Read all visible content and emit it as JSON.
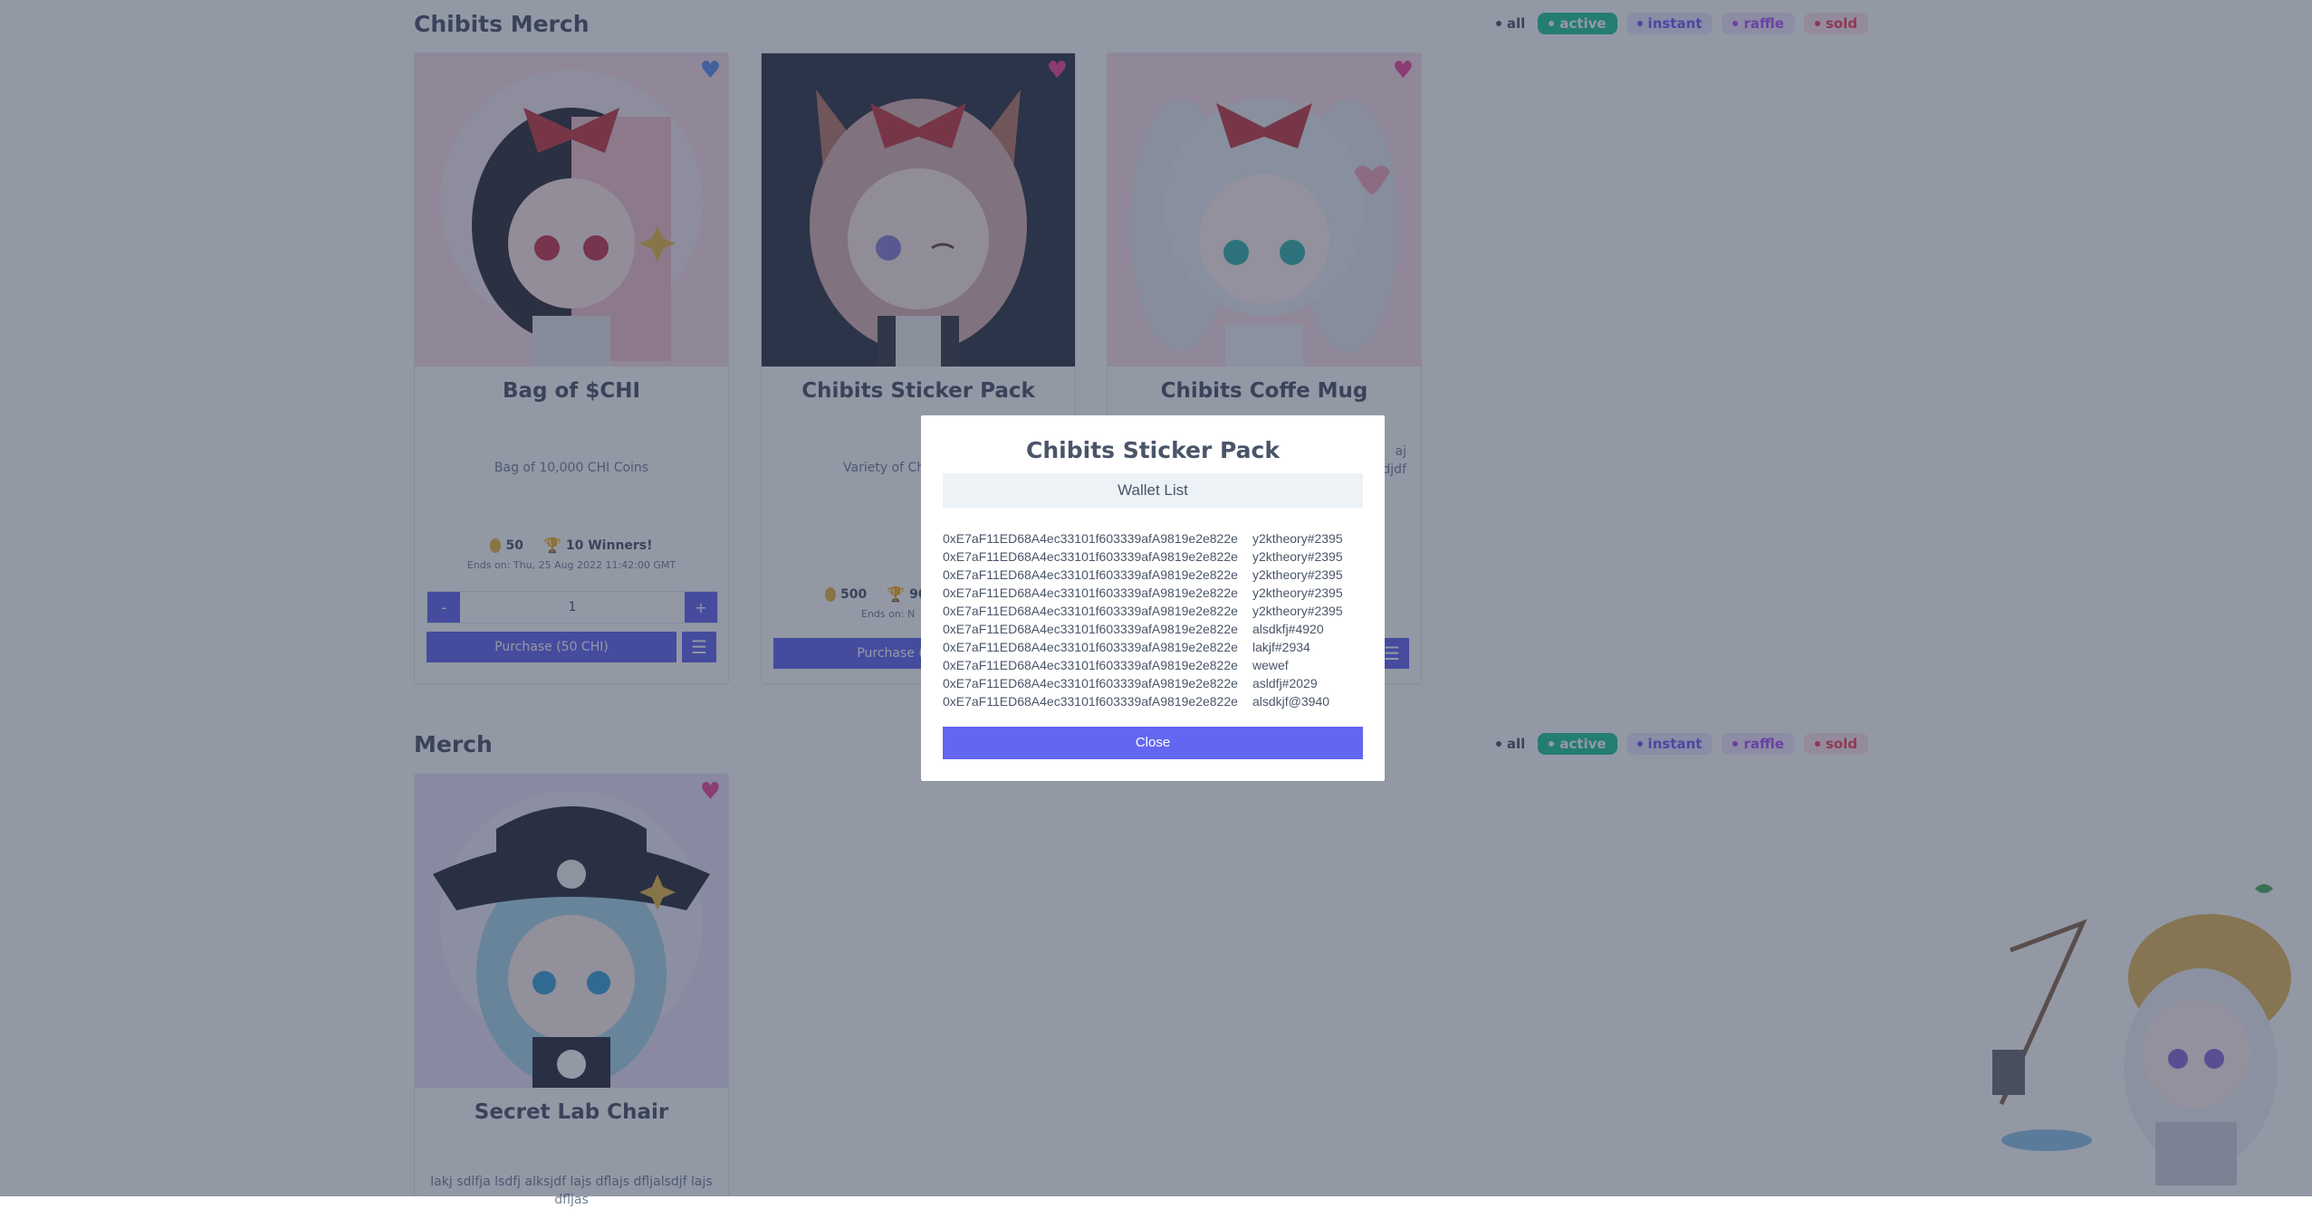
{
  "sections": [
    {
      "title": "Chibits Merch",
      "filters": [
        "all",
        "active",
        "instant",
        "raffle",
        "sold"
      ]
    },
    {
      "title": "Merch",
      "filters": [
        "all",
        "active",
        "instant",
        "raffle",
        "sold"
      ]
    }
  ],
  "cards": [
    {
      "title": "Bag of $CHI",
      "desc": "Bag of 10,000 CHI Coins",
      "price": "50",
      "winners": "10 Winners!",
      "ends": "Ends on: Thu, 25 Aug 2022 11:42:00 GMT",
      "qty_minus": "-",
      "qty": "1",
      "qty_plus": "+",
      "purchase": "Purchase (50 CHI)"
    },
    {
      "title": "Chibits Sticker Pack",
      "desc": "Variety of Ch",
      "price": "500",
      "winners": "90",
      "ends": "Ends on: N",
      "purchase": "Purchase (50"
    },
    {
      "title": "Chibits Coffe Mug",
      "desc": "aj\nsldjdf"
    },
    {
      "title": "Secret Lab Chair",
      "desc": "lakj sdlfja lsdfj alksjdf lajs dflajs dfljalsdjf lajs dfljas"
    }
  ],
  "colors": {
    "accent": "#6366f1",
    "active": "#20c997",
    "heart_blue": "#5a8ef0",
    "heart_pink": "#ec4899"
  },
  "modal": {
    "title": "Chibits Sticker Pack",
    "subtitle": "Wallet List",
    "wallets": [
      {
        "address": "0xE7aF11ED68A4ec33101f603339afA9819e2e822e",
        "name": "y2ktheory#2395"
      },
      {
        "address": "0xE7aF11ED68A4ec33101f603339afA9819e2e822e",
        "name": "y2ktheory#2395"
      },
      {
        "address": "0xE7aF11ED68A4ec33101f603339afA9819e2e822e",
        "name": "y2ktheory#2395"
      },
      {
        "address": "0xE7aF11ED68A4ec33101f603339afA9819e2e822e",
        "name": "y2ktheory#2395"
      },
      {
        "address": "0xE7aF11ED68A4ec33101f603339afA9819e2e822e",
        "name": "y2ktheory#2395"
      },
      {
        "address": "0xE7aF11ED68A4ec33101f603339afA9819e2e822e",
        "name": "alsdkfj#4920"
      },
      {
        "address": "0xE7aF11ED68A4ec33101f603339afA9819e2e822e",
        "name": "lakjf#2934"
      },
      {
        "address": "0xE7aF11ED68A4ec33101f603339afA9819e2e822e",
        "name": "wewef"
      },
      {
        "address": "0xE7aF11ED68A4ec33101f603339afA9819e2e822e",
        "name": "asldfj#2029"
      },
      {
        "address": "0xE7aF11ED68A4ec33101f603339afA9819e2e822e",
        "name": "alsdkjf@3940"
      }
    ],
    "close": "Close"
  }
}
